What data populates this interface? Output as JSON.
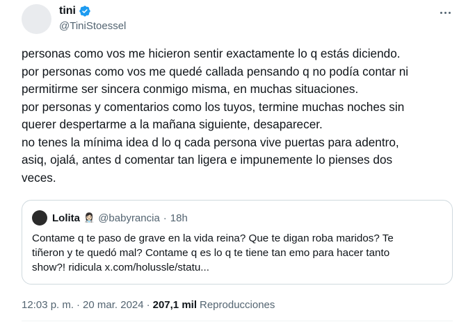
{
  "author": {
    "display_name": "tini",
    "handle": "@TiniStoessel",
    "verified": true,
    "verified_color": "#1d9bf0"
  },
  "tweet": {
    "lines": [
      "personas como vos me hicieron sentir exactamente lo q estás diciendo.",
      "por personas como vos me quedé callada pensando q no podía contar ni",
      "permitirme ser sincera conmigo misma, en muchas situaciones.",
      "por personas y comentarios como los tuyos, termine muchas noches sin",
      "querer despertarme a la mañana siguiente, desaparecer.",
      "no tenes la mínima idea d lo q cada persona vive puertas para adentro,",
      "asiq, ojalá, antes d comentar tan ligera e impunemente lo pienses dos",
      "veces."
    ]
  },
  "quoted": {
    "display_name": "Lolita",
    "emoji": "👩🏻‍⚕️",
    "handle": "@babyrancia",
    "separator": "·",
    "time": "18h",
    "lines": [
      "Contame q te paso de grave en la vida reina? Que te digan roba maridos? Te",
      "tiñeron y te quedó mal? Contame q es lo q te tiene tan emo para hacer tanto",
      "show?! ridicula x.com/holussle/statu..."
    ]
  },
  "meta": {
    "time": "12:03 p. m.",
    "sep1": "·",
    "date": "20 mar. 2024",
    "sep2": "·",
    "views": "207,1 mil",
    "views_label": "Reproducciones"
  },
  "icons": {
    "more": "more-horizontal-icon",
    "verified": "verified-badge-icon"
  }
}
